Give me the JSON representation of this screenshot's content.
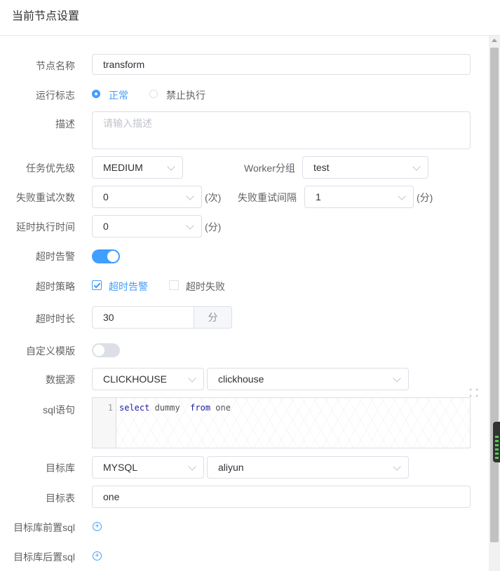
{
  "header": {
    "title": "当前节点设置"
  },
  "form": {
    "node_name": {
      "label": "节点名称",
      "value": "transform"
    },
    "run_flag": {
      "label": "运行标志",
      "options": [
        "正常",
        "禁止执行"
      ],
      "selected": "正常"
    },
    "description": {
      "label": "描述",
      "placeholder": "请输入描述"
    },
    "priority": {
      "label": "任务优先级",
      "value": "MEDIUM"
    },
    "worker_group": {
      "label": "Worker分组",
      "value": "test"
    },
    "retry_times": {
      "label": "失败重试次数",
      "value": "0",
      "unit": "(次)"
    },
    "retry_interval": {
      "label": "失败重试间隔",
      "value": "1",
      "unit": "(分)"
    },
    "delay_time": {
      "label": "延时执行时间",
      "value": "0",
      "unit": "(分)"
    },
    "timeout_alarm": {
      "label": "超时告警",
      "enabled": true
    },
    "timeout_strategy": {
      "label": "超时策略",
      "options": [
        "超时告警",
        "超时失败"
      ],
      "checked": [
        "超时告警"
      ]
    },
    "timeout_duration": {
      "label": "超时时长",
      "value": "30",
      "unit": "分"
    },
    "custom_template": {
      "label": "自定义模版",
      "enabled": false
    },
    "datasource": {
      "label": "数据源",
      "type": "CLICKHOUSE",
      "name": "clickhouse"
    },
    "sql": {
      "label": "sql语句",
      "line_number": "1",
      "tokens": [
        "select",
        " dummy  ",
        "from",
        " one"
      ]
    },
    "target_db": {
      "label": "目标库",
      "type": "MYSQL",
      "name": "aliyun"
    },
    "target_table": {
      "label": "目标表",
      "value": "one"
    },
    "pre_sql": {
      "label": "目标库前置sql"
    },
    "post_sql": {
      "label": "目标库后置sql"
    }
  },
  "colors": {
    "accent": "#409eff",
    "border": "#dcdfe6",
    "text": "#606266"
  },
  "icons": [
    "radio-selected-icon",
    "radio-icon",
    "chevron-down-icon",
    "checkbox-checked-icon",
    "checkbox-icon",
    "plus-circle-icon",
    "fullscreen-icon"
  ]
}
